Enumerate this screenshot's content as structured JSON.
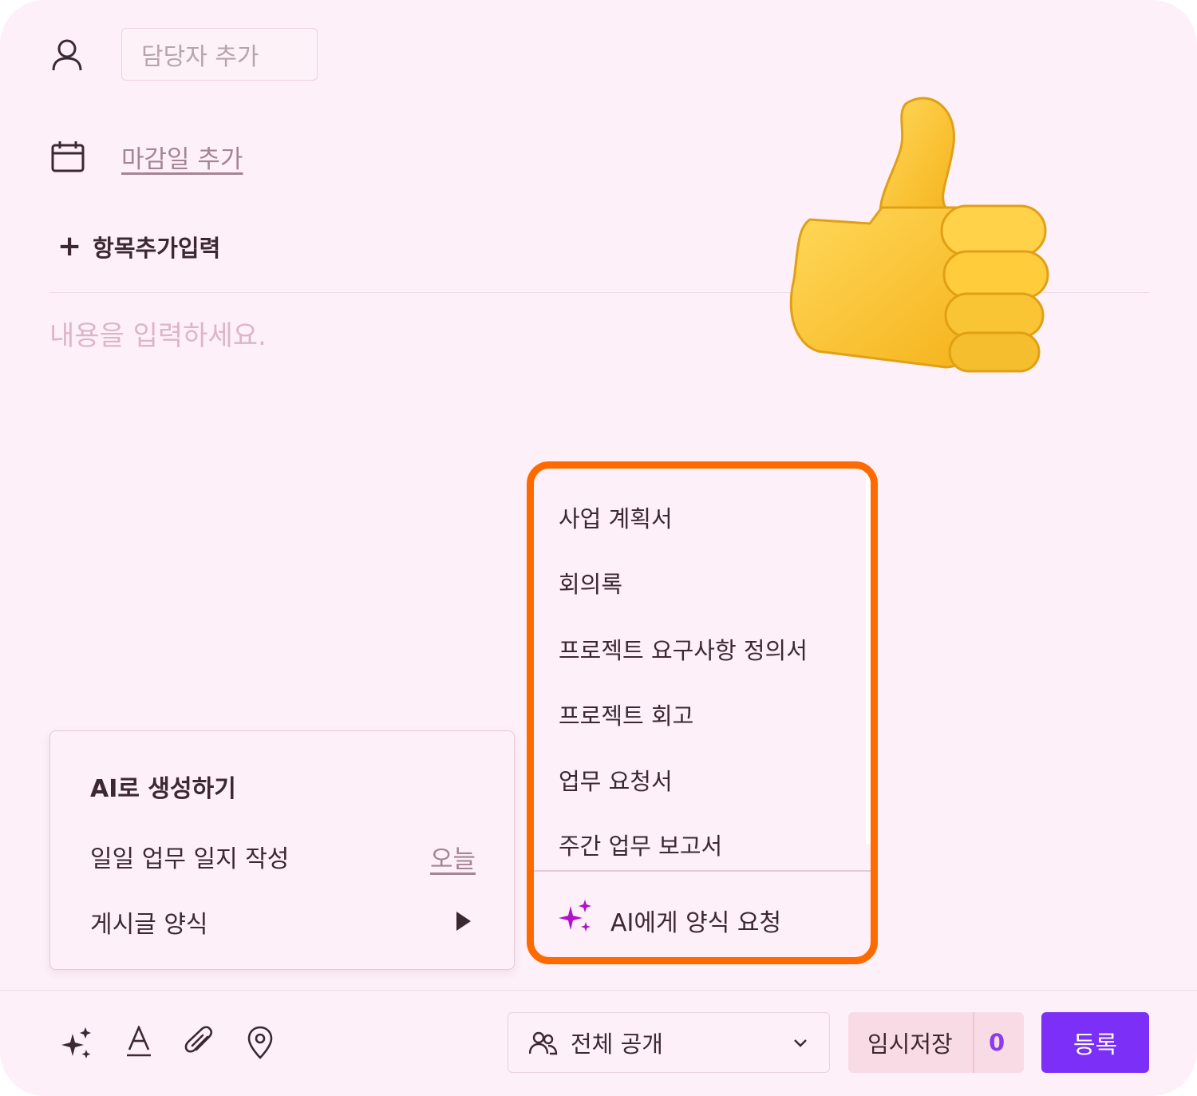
{
  "assignee": {
    "placeholder": "담당자 추가"
  },
  "due_date": {
    "label": "마감일 추가"
  },
  "add_item": {
    "label": "항목추가입력"
  },
  "content": {
    "placeholder": "내용을 입력하세요."
  },
  "ai_menu": {
    "title": "AI로 생성하기",
    "daily_log": "일일 업무 일지 작성",
    "today": "오늘",
    "post_template": "게시글 양식"
  },
  "templates": {
    "items": [
      "사업 계획서",
      "회의록",
      "프로젝트 요구사항 정의서",
      "프로젝트 회고",
      "업무 요청서",
      "주간 업무 보고서"
    ],
    "ai_request": "AI에게 양식 요청"
  },
  "footer": {
    "visibility": "전체 공개",
    "draft_label": "임시저장",
    "draft_count": "0",
    "submit": "등록"
  },
  "colors": {
    "background": "#fdf0f8",
    "highlight_border": "#ff6a00",
    "primary_button": "#7b2ff7",
    "sparkle": "#b012c8"
  },
  "icons": [
    "user-icon",
    "calendar-icon",
    "plus-icon",
    "thumbs-up-icon",
    "play-arrow-icon",
    "sparkle-icon",
    "text-format-icon",
    "paperclip-icon",
    "location-pin-icon",
    "people-icon",
    "chevron-down-icon"
  ]
}
